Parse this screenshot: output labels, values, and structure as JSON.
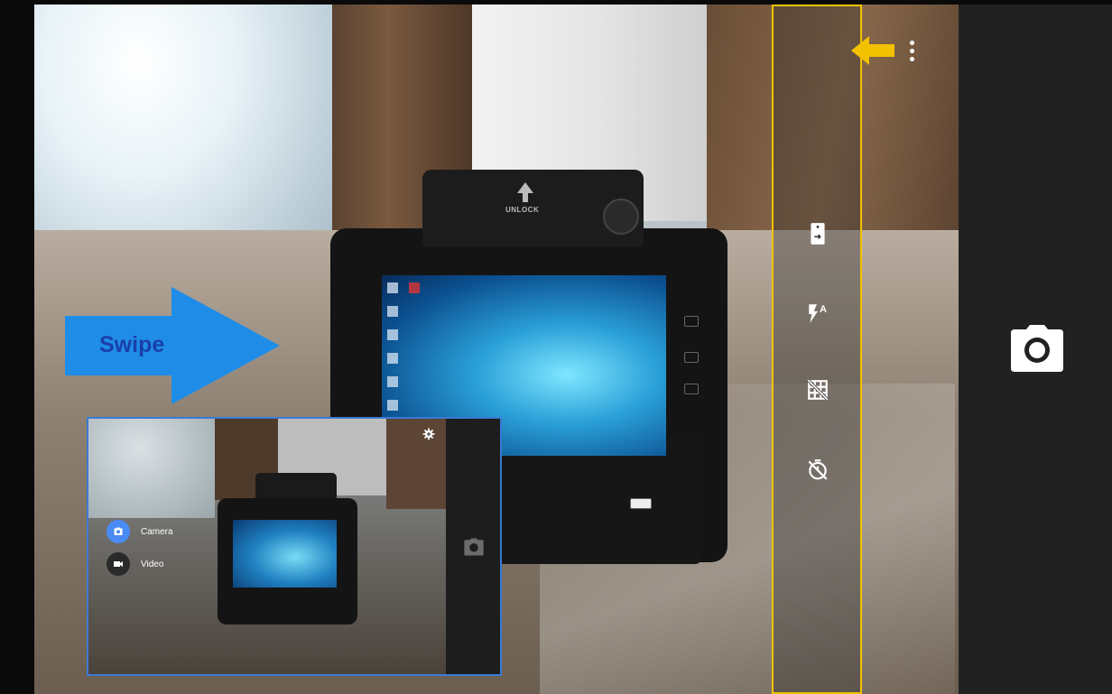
{
  "overlay": {
    "swipe_label": "Swipe"
  },
  "device_screen": {
    "unlock_label": "UNLOCK"
  },
  "settings_panel": {
    "items": [
      {
        "name": "camera-switch",
        "icon": "camera-switch-icon"
      },
      {
        "name": "flash-auto",
        "icon": "flash-auto-icon"
      },
      {
        "name": "grid-off",
        "icon": "grid-off-icon"
      },
      {
        "name": "timer-off",
        "icon": "timer-off-icon"
      }
    ],
    "highlight_color": "#f2c200"
  },
  "menu": {
    "icon": "more-vert-icon"
  },
  "control_bar": {
    "shutter_icon": "camera-icon"
  },
  "inset": {
    "modes": [
      {
        "label": "Camera",
        "active": true,
        "icon": "camera-icon",
        "color": "#4a8af4"
      },
      {
        "label": "Video",
        "active": false,
        "icon": "video-icon",
        "color": "#2a2a2a"
      }
    ],
    "border_color": "#3a7bd5"
  },
  "colors": {
    "swipe_arrow": "#1f8de8",
    "swipe_text": "#1a3fa8",
    "callout_arrow": "#f2c200",
    "control_bar": "#212121"
  }
}
